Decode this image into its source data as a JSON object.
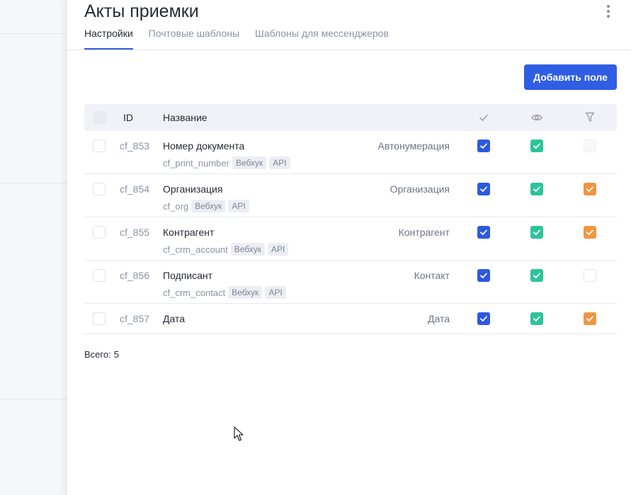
{
  "header": {
    "title": "Акты приемки"
  },
  "tabs": [
    {
      "label": "Настройки",
      "active": true
    },
    {
      "label": "Почтовые шаблоны",
      "active": false
    },
    {
      "label": "Шаблоны для мессенджеров",
      "active": false
    }
  ],
  "toolbar": {
    "add_label": "Добавить поле"
  },
  "table": {
    "columns": {
      "id": "ID",
      "name": "Название",
      "required_icon": "check-icon",
      "visible_icon": "eye-icon",
      "filter_icon": "filter-icon"
    },
    "rows": [
      {
        "id": "cf_853",
        "name": "Номер документа",
        "code": "cf_print_number",
        "tags": [
          "Вебхук",
          "API"
        ],
        "type": "Автонумерация",
        "required": true,
        "visible": true,
        "filter": false,
        "filter_disabled": true
      },
      {
        "id": "cf_854",
        "name": "Организация",
        "code": "cf_org",
        "tags": [
          "Вебхук",
          "API"
        ],
        "type": "Организация",
        "required": true,
        "visible": true,
        "filter": true,
        "filter_disabled": false
      },
      {
        "id": "cf_855",
        "name": "Контрагент",
        "code": "cf_crm_account",
        "tags": [
          "Вебхук",
          "API"
        ],
        "type": "Контрагент",
        "required": true,
        "visible": true,
        "filter": true,
        "filter_disabled": false
      },
      {
        "id": "cf_856",
        "name": "Подписант",
        "code": "cf_crm_contact",
        "tags": [
          "Вебхук",
          "API"
        ],
        "type": "Контакт",
        "required": true,
        "visible": true,
        "filter": false,
        "filter_disabled": false
      },
      {
        "id": "cf_857",
        "name": "Дата",
        "code": "",
        "tags": [],
        "type": "Дата",
        "required": true,
        "visible": true,
        "filter": true,
        "filter_disabled": false
      }
    ]
  },
  "footer": {
    "total_label": "Всего:",
    "total_value": "5"
  },
  "colors": {
    "accent": "#2f5ee5",
    "required": "#2d59e0",
    "visible": "#2dc49b",
    "filter": "#ef9642"
  }
}
